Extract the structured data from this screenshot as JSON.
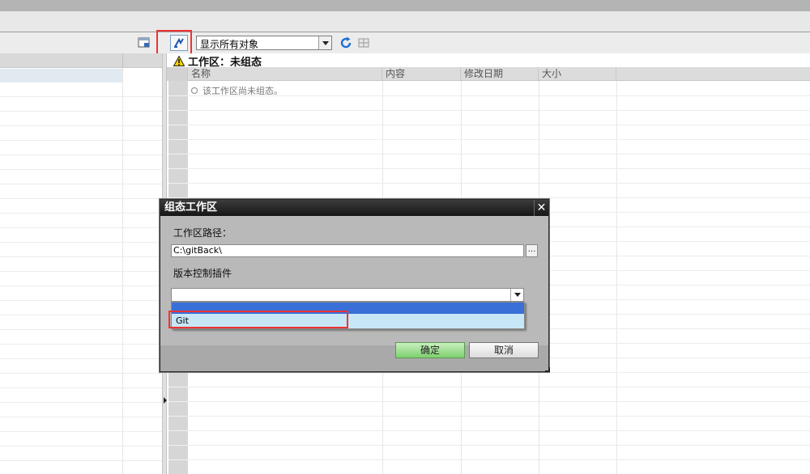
{
  "toolbar": {
    "filter_value": "显示所有对象"
  },
  "workspace": {
    "title": "工作区：未组态",
    "empty_message": "该工作区尚未组态。"
  },
  "grid": {
    "columns": [
      "名称",
      "内容",
      "修改日期",
      "大小"
    ]
  },
  "dialog": {
    "title": "组态工作区",
    "path_label": "工作区路径：",
    "path_value": "C:\\gitBack\\",
    "browse_label": "...",
    "plugin_label": "版本控制插件",
    "plugin_value": "",
    "options": [
      "",
      "Git"
    ],
    "ok_label": "确定",
    "cancel_label": "取消"
  },
  "colors": {
    "highlight": "#e33333",
    "selection": "#3a6fd8",
    "hover_option": "#c8e7f6",
    "ok_button": "#7ed06e"
  }
}
